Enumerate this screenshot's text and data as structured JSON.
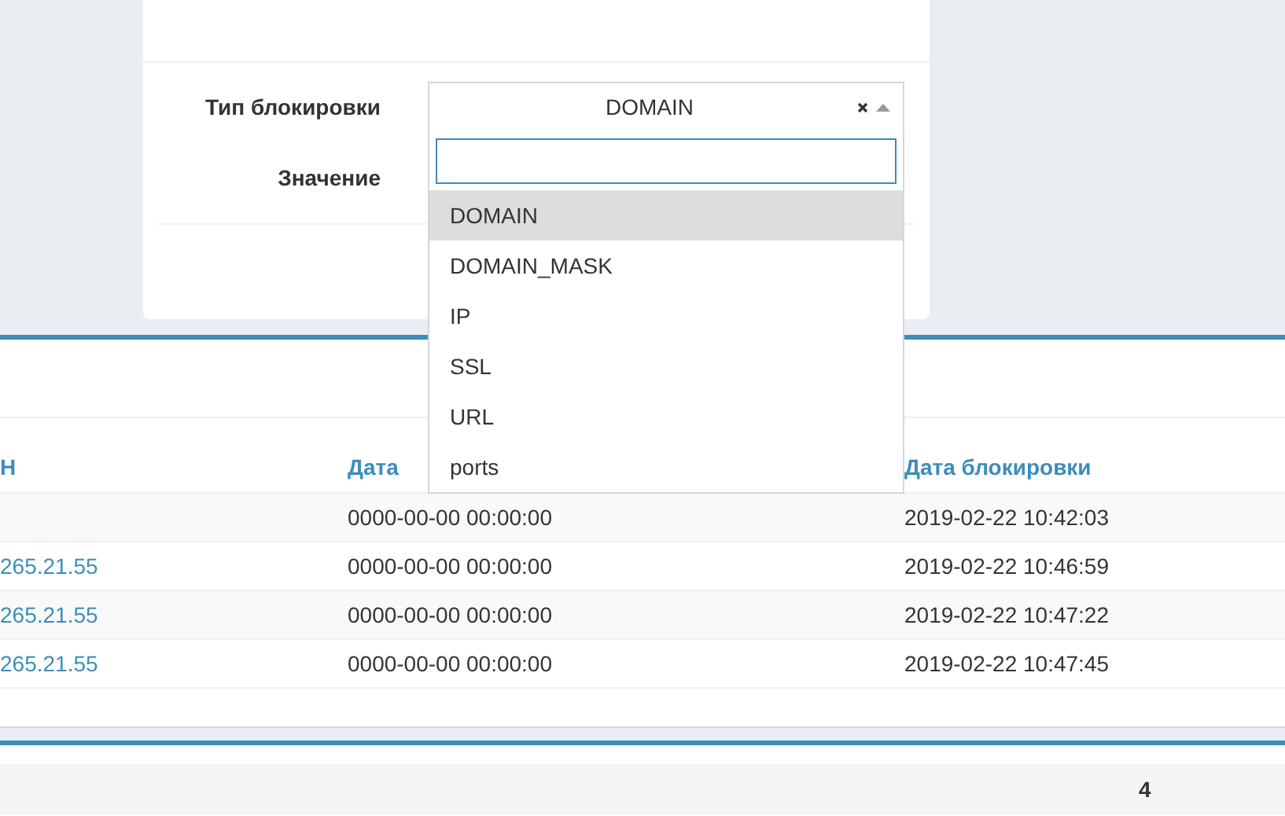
{
  "form": {
    "fields": [
      {
        "label": "Тип блокировки",
        "value": "DOMAIN"
      },
      {
        "label": "Значение"
      }
    ]
  },
  "dropdown": {
    "options": [
      {
        "label": "DOMAIN",
        "selected": true
      },
      {
        "label": "DOMAIN_MASK",
        "selected": false
      },
      {
        "label": "IP",
        "selected": false
      },
      {
        "label": "SSL",
        "selected": false
      },
      {
        "label": "URL",
        "selected": false
      },
      {
        "label": "ports",
        "selected": false
      }
    ]
  },
  "table": {
    "columns": [
      "Н",
      "Дата",
      "Дата блокировки"
    ],
    "rows": [
      {
        "date": "0000-00-00 00:00:00",
        "blocked_at": "2019-02-22 10:42:03"
      },
      {
        "column_1": "265.21.55",
        "date": "0000-00-00 00:00:00",
        "blocked_at": "2019-02-22 10:46:59"
      },
      {
        "column_1": "265.21.55",
        "date": "0000-00-00 00:00:00",
        "blocked_at": "2019-02-22 10:47:22"
      },
      {
        "column_1": "265.21.55",
        "date": "0000-00-00 00:00:00",
        "blocked_at": "2019-02-22 10:47:45"
      }
    ]
  },
  "footer": {
    "count": "4"
  }
}
